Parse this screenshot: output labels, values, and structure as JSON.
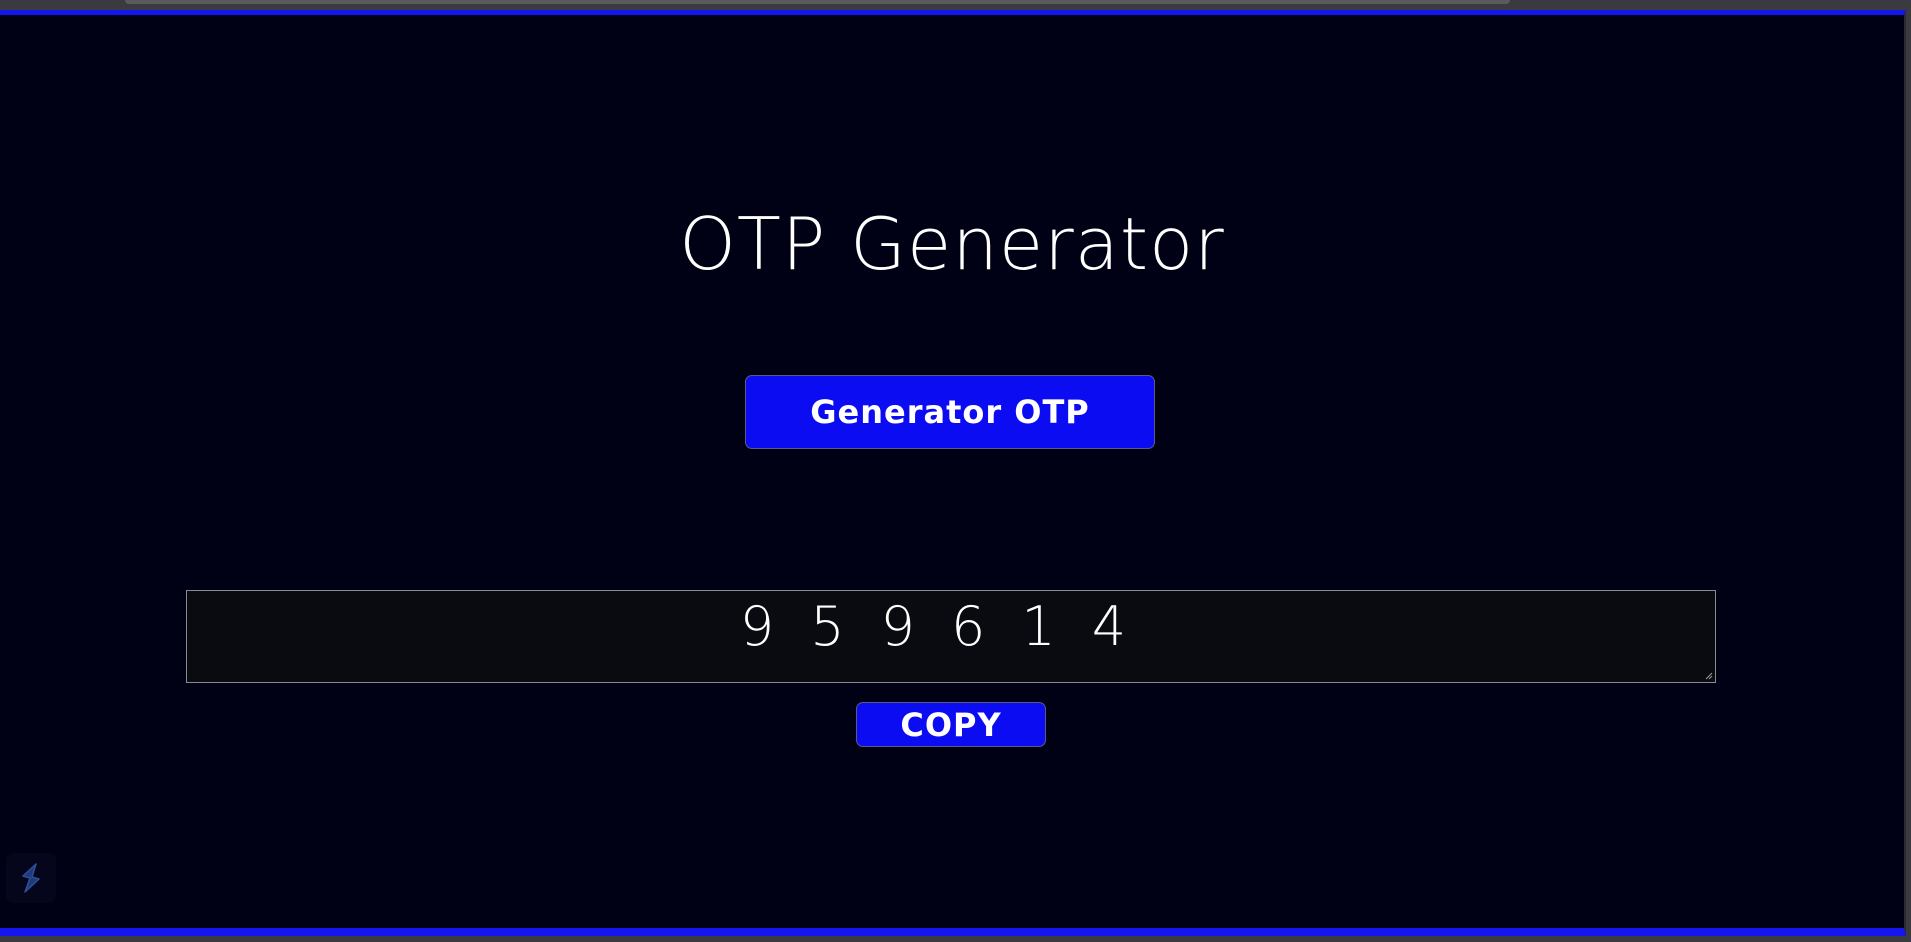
{
  "page": {
    "title": "OTP Generator"
  },
  "actions": {
    "generate_label": "Generator OTP",
    "copy_label": "COPY"
  },
  "otp": {
    "value": "959614"
  },
  "colors": {
    "background": "#010116",
    "accent": "#0c0cf2",
    "text": "#ffffff",
    "field_bg": "#0a0b10"
  },
  "icons": {
    "corner_logo": "extension-logo-icon"
  }
}
